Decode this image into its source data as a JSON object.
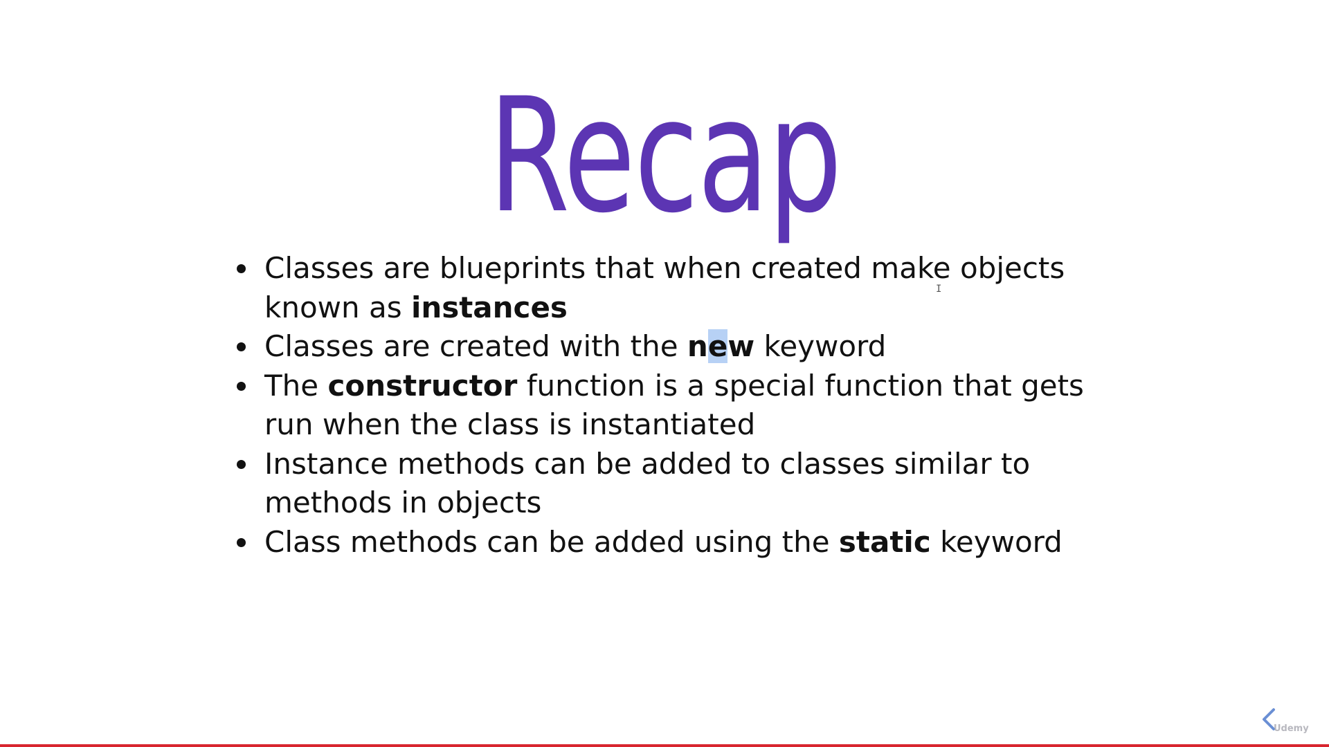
{
  "slide": {
    "title": "Recap",
    "bullets": [
      [
        {
          "text": "Classes are blueprints that when created make objects known as "
        },
        {
          "text": "instances",
          "bold": true
        }
      ],
      [
        {
          "text": "Classes are created with the "
        },
        {
          "text": "n",
          "bold": true
        },
        {
          "text": "e",
          "bold": true,
          "highlight": true
        },
        {
          "text": "w",
          "bold": true
        },
        {
          "text": " keyword"
        }
      ],
      [
        {
          "text": "The "
        },
        {
          "text": "constructor",
          "bold": true
        },
        {
          "text": " function is a special function that gets run when the class is instantiated"
        }
      ],
      [
        {
          "text": "Instance methods can be added to classes similar to methods in objects"
        }
      ],
      [
        {
          "text": "Class methods can be added using the "
        },
        {
          "text": "static",
          "bold": true
        },
        {
          "text": " keyword"
        }
      ]
    ]
  },
  "player": {
    "prev_icon": "chevron-left-icon",
    "brand_label": "Udemy",
    "progress_fraction": 1.0
  },
  "colors": {
    "title": "#5c35b3",
    "text": "#111111",
    "highlight": "#b7d1f5",
    "progress": "#d8262f",
    "nav_icon": "#6a8fd4"
  }
}
